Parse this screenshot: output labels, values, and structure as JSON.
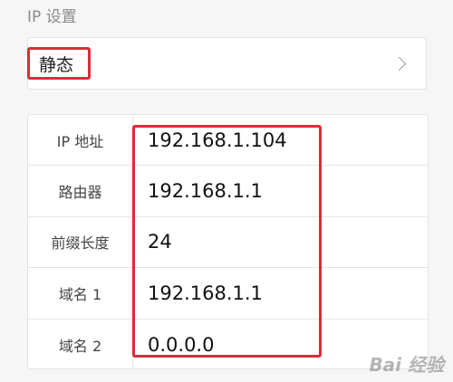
{
  "section": {
    "title": "IP 设置"
  },
  "mode": {
    "value": "静态"
  },
  "rows": [
    {
      "label": "IP 地址",
      "value": "192.168.1.104"
    },
    {
      "label": "路由器",
      "value": "192.168.1.1"
    },
    {
      "label": "前缀长度",
      "value": "24"
    },
    {
      "label": "域名 1",
      "value": "192.168.1.1"
    },
    {
      "label": "域名 2",
      "value": "0.0.0.0"
    }
  ],
  "watermark": {
    "text": "Bai 经验"
  },
  "colors": {
    "highlight": "#e02a3a",
    "background": "#f6f6f6"
  }
}
